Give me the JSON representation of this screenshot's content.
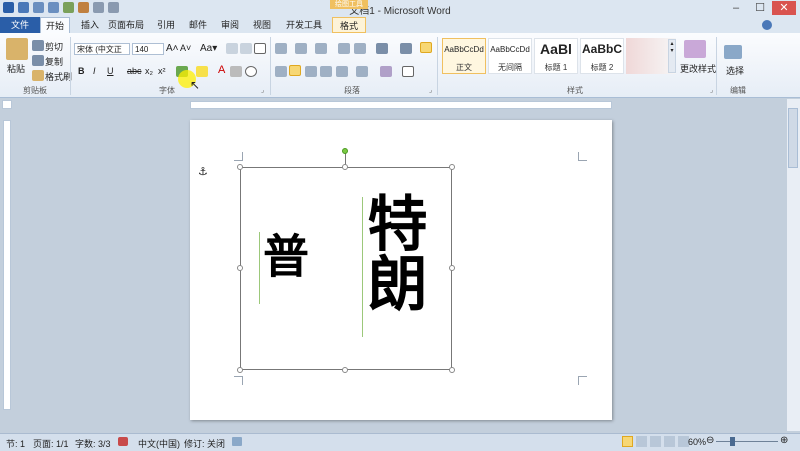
{
  "window": {
    "title": "文档1 - Microsoft Word",
    "context_tab": "绘图工具"
  },
  "tabs": [
    {
      "label": "文件"
    },
    {
      "label": "开始"
    },
    {
      "label": "插入"
    },
    {
      "label": "页面布局"
    },
    {
      "label": "引用"
    },
    {
      "label": "邮件"
    },
    {
      "label": "审阅"
    },
    {
      "label": "视图"
    },
    {
      "label": "开发工具"
    },
    {
      "label": "格式"
    }
  ],
  "clipboard": {
    "paste": "粘贴",
    "cut": "剪切",
    "copy": "复制",
    "format_painter": "格式刷",
    "group": "剪贴板"
  },
  "font": {
    "name": "宋体 (中文正",
    "size": "140",
    "group": "字体"
  },
  "paragraph": {
    "group": "段落"
  },
  "styles": {
    "group": "样式",
    "items": [
      {
        "sample": "AaBbCcDd",
        "name": "正文"
      },
      {
        "sample": "AaBbCcDd",
        "name": "无间隔"
      },
      {
        "sample": "AaBl",
        "name": "标题 1"
      },
      {
        "sample": "AaBbC",
        "name": "标题 2"
      }
    ],
    "change": "更改样式"
  },
  "editing": {
    "select": "选择",
    "group": "编辑"
  },
  "document": {
    "text_right": "特朗",
    "text_left": "普"
  },
  "status": {
    "page_section": "节: 1",
    "page": "页面: 1/1",
    "words": "字数: 3/3",
    "language": "中文(中国)",
    "track": "修订: 关闭",
    "zoom": "60%"
  },
  "colors": {
    "accent": "#2a5ea8",
    "ribbon_bg": "#e6edf6",
    "highlight": "#f0c060"
  }
}
